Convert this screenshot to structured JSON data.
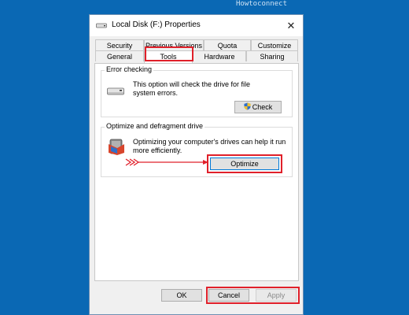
{
  "watermark": "Howtoconnect",
  "window": {
    "title": "Local Disk (F:) Properties",
    "close_label": "✕"
  },
  "tabs_row1": [
    {
      "label": "Security"
    },
    {
      "label": "Previous Versions"
    },
    {
      "label": "Quota"
    },
    {
      "label": "Customize"
    }
  ],
  "tabs_row2": [
    {
      "label": "General"
    },
    {
      "label": "Tools"
    },
    {
      "label": "Hardware"
    },
    {
      "label": "Sharing"
    }
  ],
  "error_checking": {
    "title": "Error checking",
    "description_line1": "This option will check the drive for file",
    "description_line2": "system errors.",
    "button_label": "Check"
  },
  "optimize": {
    "title": "Optimize and defragment drive",
    "description_line1": "Optimizing your computer's drives can help it run",
    "description_line2": "more efficiently.",
    "button_label": "Optimize"
  },
  "footer": {
    "ok_label": "OK",
    "cancel_label": "Cancel",
    "apply_label": "Apply"
  },
  "colors": {
    "desktop": "#0a68b4",
    "annotation_red": "#e0202a",
    "focus_blue": "#0078d7"
  }
}
